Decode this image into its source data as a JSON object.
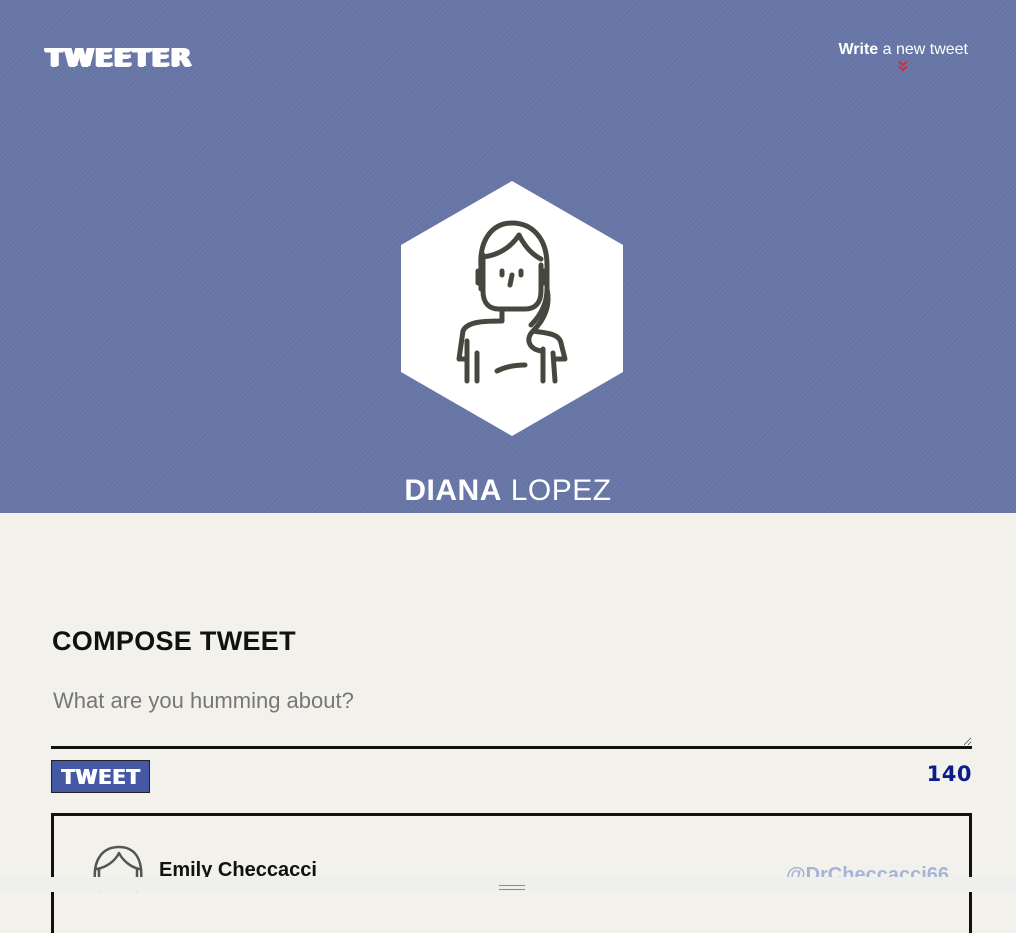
{
  "header": {
    "logo": "TWEETER",
    "compose_toggle": {
      "bold": "Write",
      "rest": " a new tweet",
      "icon": "double-chevron-down-icon",
      "icon_color": "#d42a3f"
    },
    "background_color": "#6776a7"
  },
  "profile": {
    "avatar_icon": "woman-avatar-icon",
    "first_name": "DIANA",
    "last_name": "LOPEZ"
  },
  "compose": {
    "title": "COMPOSE TWEET",
    "placeholder": "What are you humming about?",
    "button_label": "TWEET",
    "button_color": "#4458a3",
    "counter": "140",
    "counter_color": "#0b1c8c"
  },
  "tweets": [
    {
      "avatar_icon": "man-avatar-icon",
      "author": "Emily Checcacci",
      "handle": "@DrCheccacci66"
    }
  ],
  "colors": {
    "page_background": "#f3f1eb",
    "handle_color": "#a8b4d6"
  }
}
